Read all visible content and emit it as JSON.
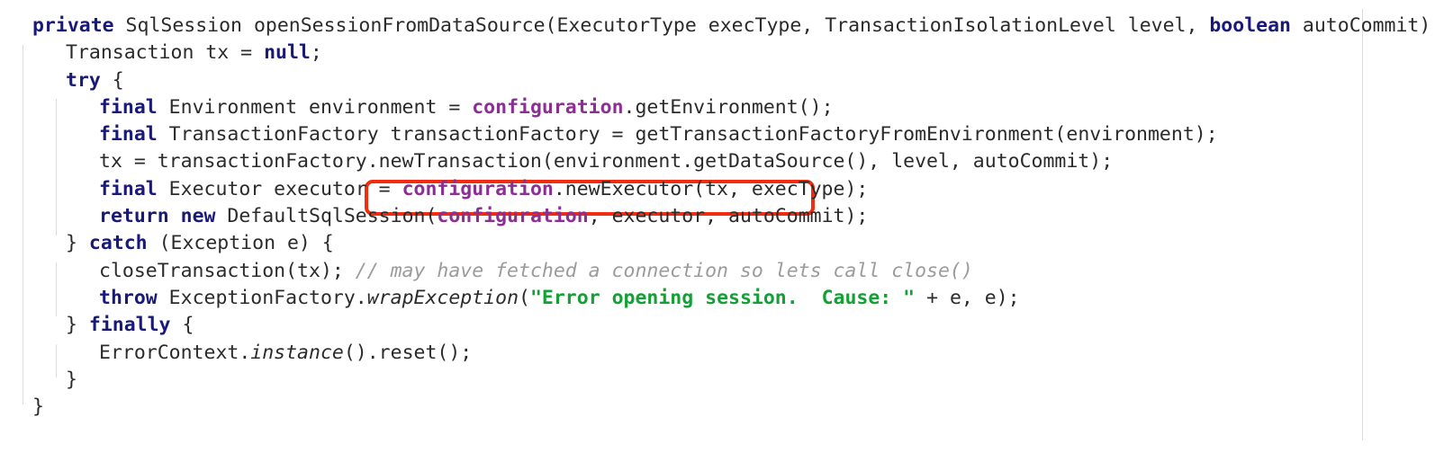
{
  "editor": {
    "language": "java",
    "background": "#ffffff",
    "colors": {
      "keyword": "#19197a",
      "plain": "#2b2b2b",
      "field": "#8b2f93",
      "string": "#13a035",
      "comment": "#9b9b9b",
      "annotation": "#f22c11",
      "guide": "#dddddd"
    },
    "annotation": {
      "shape": "rounded-rectangle",
      "color": "#f22c11",
      "target_text": "configuration.newExecutor(tx, execType);",
      "line_index": 6
    },
    "lines": [
      {
        "indent": 0,
        "tokens": [
          {
            "t": "private",
            "c": "kw"
          },
          {
            "t": " SqlSession openSessionFromDataSource(ExecutorType execType, TransactionIsolationLevel level, ",
            "c": "plain"
          },
          {
            "t": "boolean",
            "c": "kw"
          },
          {
            "t": " autoCommit) {",
            "c": "plain"
          }
        ]
      },
      {
        "indent": 1,
        "tokens": [
          {
            "t": "Transaction tx = ",
            "c": "plain"
          },
          {
            "t": "null",
            "c": "kw"
          },
          {
            "t": ";",
            "c": "plain"
          }
        ]
      },
      {
        "indent": 1,
        "tokens": [
          {
            "t": "try",
            "c": "kw"
          },
          {
            "t": " {",
            "c": "plain"
          }
        ]
      },
      {
        "indent": 2,
        "tokens": [
          {
            "t": "final",
            "c": "kw"
          },
          {
            "t": " Environment environment = ",
            "c": "plain"
          },
          {
            "t": "configuration",
            "c": "field"
          },
          {
            "t": ".getEnvironment();",
            "c": "plain"
          }
        ]
      },
      {
        "indent": 2,
        "tokens": [
          {
            "t": "final",
            "c": "kw"
          },
          {
            "t": " TransactionFactory transactionFactory = getTransactionFactoryFromEnvironment(environment);",
            "c": "plain"
          }
        ]
      },
      {
        "indent": 2,
        "tokens": [
          {
            "t": "tx = transactionFactory.newTransaction(environment.getDataSource(), level, autoCommit);",
            "c": "plain"
          }
        ]
      },
      {
        "indent": 2,
        "tokens": [
          {
            "t": "final",
            "c": "kw"
          },
          {
            "t": " Executor executor = ",
            "c": "plain"
          },
          {
            "t": "configuration",
            "c": "field"
          },
          {
            "t": ".newExecutor(tx, execType);",
            "c": "plain"
          }
        ]
      },
      {
        "indent": 2,
        "tokens": [
          {
            "t": "return",
            "c": "kw"
          },
          {
            "t": " ",
            "c": "plain"
          },
          {
            "t": "new",
            "c": "kw"
          },
          {
            "t": " DefaultSqlSession(",
            "c": "plain"
          },
          {
            "t": "configuration",
            "c": "field"
          },
          {
            "t": ", executor, autoCommit);",
            "c": "plain"
          }
        ]
      },
      {
        "indent": 1,
        "tokens": [
          {
            "t": "} ",
            "c": "plain"
          },
          {
            "t": "catch",
            "c": "kw"
          },
          {
            "t": " (Exception e) {",
            "c": "plain"
          }
        ]
      },
      {
        "indent": 2,
        "tokens": [
          {
            "t": "closeTransaction(tx); ",
            "c": "plain"
          },
          {
            "t": "// may have fetched a connection so lets call close()",
            "c": "cmt"
          }
        ]
      },
      {
        "indent": 2,
        "tokens": [
          {
            "t": "throw",
            "c": "kw"
          },
          {
            "t": " ExceptionFactory.",
            "c": "plain"
          },
          {
            "t": "wrapException",
            "c": "mth"
          },
          {
            "t": "(",
            "c": "plain"
          },
          {
            "t": "\"Error opening session.  Cause: \"",
            "c": "str"
          },
          {
            "t": " + e, e);",
            "c": "plain"
          }
        ]
      },
      {
        "indent": 1,
        "tokens": [
          {
            "t": "} ",
            "c": "plain"
          },
          {
            "t": "finally",
            "c": "kw"
          },
          {
            "t": " {",
            "c": "plain"
          }
        ]
      },
      {
        "indent": 2,
        "tokens": [
          {
            "t": "ErrorContext.",
            "c": "plain"
          },
          {
            "t": "instance",
            "c": "mth"
          },
          {
            "t": "().reset();",
            "c": "plain"
          }
        ]
      },
      {
        "indent": 1,
        "tokens": [
          {
            "t": "}",
            "c": "plain"
          }
        ]
      },
      {
        "indent": 0,
        "tokens": [
          {
            "t": "}",
            "c": "plain"
          }
        ]
      }
    ]
  }
}
